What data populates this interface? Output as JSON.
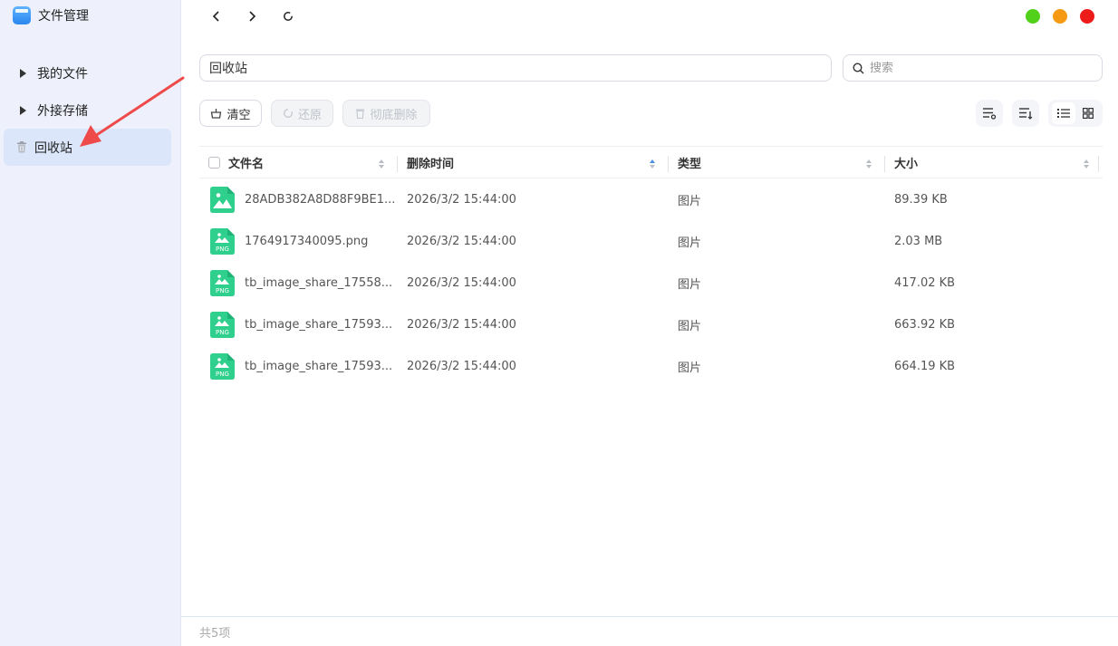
{
  "app": {
    "title": "文件管理"
  },
  "sidebar": {
    "items": [
      {
        "label": "我的文件"
      },
      {
        "label": "外接存储"
      },
      {
        "label": "回收站"
      }
    ]
  },
  "window_controls": {
    "colors": [
      "#52d11a",
      "#f59a12",
      "#ee1b1b"
    ]
  },
  "path": {
    "value": "回收站"
  },
  "search": {
    "placeholder": "搜索"
  },
  "toolbar": {
    "clear_label": "清空",
    "restore_label": "还原",
    "delete_label": "彻底删除"
  },
  "table": {
    "columns": [
      "文件名",
      "删除时间",
      "类型",
      "大小"
    ],
    "rows": [
      {
        "name": "28ADB382A8D88F9BE1...",
        "deleted": "2026/3/2 15:44:00",
        "type": "图片",
        "size": "89.39 KB",
        "badge": ""
      },
      {
        "name": "1764917340095.png",
        "deleted": "2026/3/2 15:44:00",
        "type": "图片",
        "size": "2.03 MB",
        "badge": "PNG"
      },
      {
        "name": "tb_image_share_17558...",
        "deleted": "2026/3/2 15:44:00",
        "type": "图片",
        "size": "417.02 KB",
        "badge": "PNG"
      },
      {
        "name": "tb_image_share_17593...",
        "deleted": "2026/3/2 15:44:00",
        "type": "图片",
        "size": "663.92 KB",
        "badge": "PNG"
      },
      {
        "name": "tb_image_share_17593...",
        "deleted": "2026/3/2 15:44:00",
        "type": "图片",
        "size": "664.19 KB",
        "badge": "PNG"
      }
    ]
  },
  "footer": {
    "count_text": "共5项"
  },
  "colors": {
    "accent": "#4a90e2",
    "sidebar_bg": "#eef1fb",
    "active_bg": "#dbe6fb",
    "file_icon": "#2fcf8d",
    "annotation_arrow": "#ee4a4a"
  }
}
